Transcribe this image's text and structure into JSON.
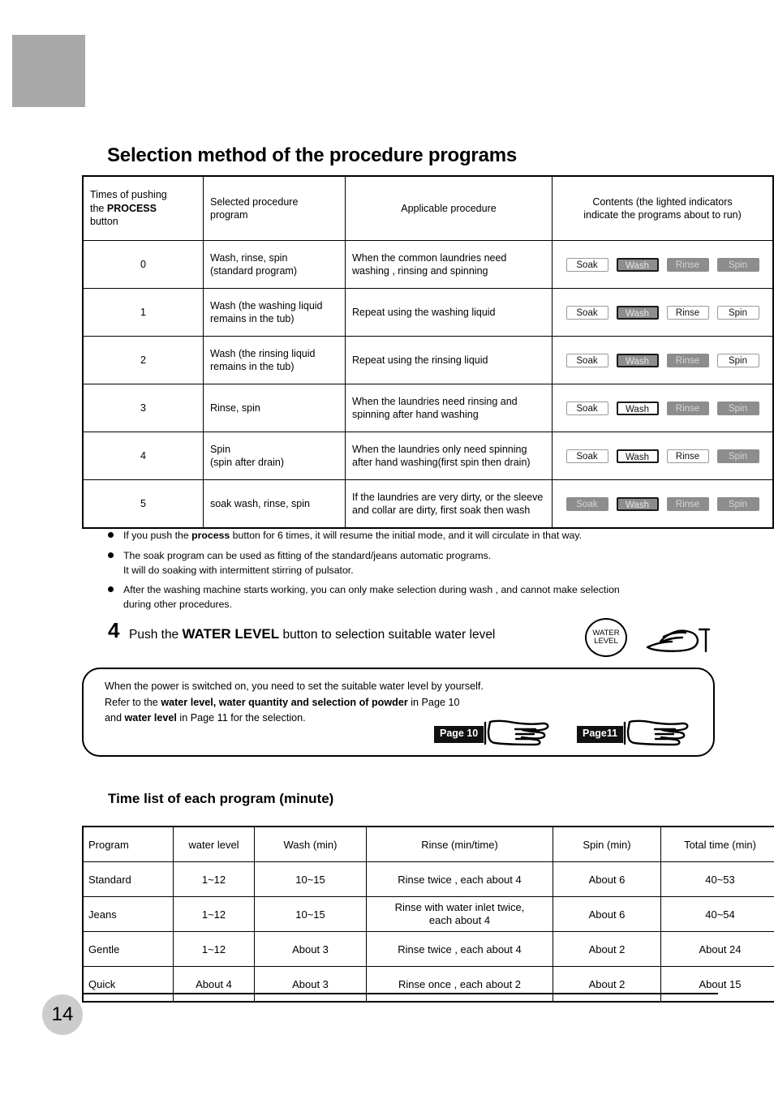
{
  "page": {
    "number": "14",
    "heading": "Selection method of the procedure programs"
  },
  "procedure_table": {
    "headers": {
      "times_line1": "Times of pushing",
      "times_line2_pre": "the ",
      "times_line2_strong": "PROCESS",
      "times_line3": "button",
      "selected_line1": "Selected procedure",
      "selected_line2": "program",
      "applicable": "Applicable procedure",
      "contents_line1": "Contents (the lighted indicators",
      "contents_line2": "indicate the programs about to run)"
    },
    "indicator_labels": [
      "Soak",
      "Wash",
      "Rinse",
      "Spin"
    ],
    "rows": [
      {
        "times": "0",
        "selected": "Wash, rinse, spin\n(standard program)",
        "applicable": "When the common laundries need\nwashing ,  rinsing  and spinning",
        "indicators": [
          {
            "label": "Soak",
            "state": "off"
          },
          {
            "label": "Wash",
            "state": "active"
          },
          {
            "label": "Rinse",
            "state": "lit"
          },
          {
            "label": "Spin",
            "state": "lit"
          }
        ]
      },
      {
        "times": "1",
        "selected": "Wash (the washing liquid\nremains  in the tub)",
        "applicable": "Repeat using the washing liquid",
        "indicators": [
          {
            "label": "Soak",
            "state": "off"
          },
          {
            "label": "Wash",
            "state": "active"
          },
          {
            "label": "Rinse",
            "state": "off"
          },
          {
            "label": "Spin",
            "state": "off"
          }
        ]
      },
      {
        "times": "2",
        "selected": "Wash (the rinsing liquid\nremains  in the tub)",
        "applicable": "Repeat using the rinsing liquid",
        "indicators": [
          {
            "label": "Soak",
            "state": "off"
          },
          {
            "label": "Wash",
            "state": "active"
          },
          {
            "label": "Rinse",
            "state": "lit"
          },
          {
            "label": "Spin",
            "state": "off"
          }
        ]
      },
      {
        "times": "3",
        "selected": "Rinse, spin",
        "applicable": "When the laundries need rinsing and\nspinning after hand  washing",
        "indicators": [
          {
            "label": "Soak",
            "state": "off"
          },
          {
            "label": "Wash",
            "state": "active-off"
          },
          {
            "label": "Rinse",
            "state": "lit"
          },
          {
            "label": "Spin",
            "state": "lit"
          }
        ]
      },
      {
        "times": "4",
        "selected": "Spin\n(spin after drain)",
        "applicable": "When the laundries only  need spinning\nafter hand washing(first spin then drain)",
        "indicators": [
          {
            "label": "Soak",
            "state": "off"
          },
          {
            "label": "Wash",
            "state": "active-off"
          },
          {
            "label": "Rinse",
            "state": "off"
          },
          {
            "label": "Spin",
            "state": "lit"
          }
        ]
      },
      {
        "times": "5",
        "selected": "soak  wash, rinse, spin",
        "applicable": "If the laundries are very dirty, or the sleeve\nand collar are dirty, first soak then wash",
        "indicators": [
          {
            "label": "Soak",
            "state": "lit"
          },
          {
            "label": "Wash",
            "state": "active"
          },
          {
            "label": "Rinse",
            "state": "lit"
          },
          {
            "label": "Spin",
            "state": "lit"
          }
        ]
      }
    ]
  },
  "bullets": [
    {
      "pre": "If you push the  ",
      "strong": "process",
      "post": "   button for 6 times, it will resume the initial mode, and it will circulate in that way."
    },
    {
      "pre": "The soak program can be used as fitting of the standard/jeans automatic programs.",
      "strong": "",
      "post": "",
      "second_line": "It will do soaking with intermittent stirring of pulsator."
    },
    {
      "pre": "After the washing machine starts working, you can only make selection during wash , and cannot make selection",
      "strong": "",
      "post": "",
      "second_line": "during other procedures."
    }
  ],
  "step4": {
    "number": "4",
    "text_pre": "Push the  ",
    "text_strong": "WATER LEVEL",
    "text_post": " button to selection suitable water level",
    "button_icon_line1": "WATER",
    "button_icon_line2": "LEVEL"
  },
  "note_box": {
    "line1": "When the power is switched on, you need to set the suitable water level by yourself.",
    "line2_pre": "Refer to the ",
    "line2_strong": "water level, water quantity and selection of powder",
    "line2_post": " in Page 10",
    "line3_pre": "and ",
    "line3_strong": "water level",
    "line3_post": " in Page 11 for the selection.",
    "tag1": "Page 10",
    "tag2": "Page11"
  },
  "time_list": {
    "title": "Time list of each program (minute)",
    "headers": [
      "Program",
      "water level",
      "Wash (min)",
      "Rinse (min/time)",
      "Spin (min)",
      "Total time (min)"
    ],
    "rows": [
      {
        "program": "Standard",
        "water_level": "1~12",
        "wash": "10~15",
        "rinse": "Rinse twice , each about 4",
        "spin": "About 6",
        "total": "40~53"
      },
      {
        "program": "Jeans",
        "water_level": "1~12",
        "wash": "10~15",
        "rinse": "Rinse with water inlet twice,\neach about 4",
        "spin": "About 6",
        "total": "40~54"
      },
      {
        "program": "Gentle",
        "water_level": "1~12",
        "wash": "About 3",
        "rinse": "Rinse twice , each about 4",
        "spin": "About 2",
        "total": "About 24"
      },
      {
        "program": "Quick",
        "water_level": "About  4",
        "wash": "About 3",
        "rinse": "Rinse once , each about 2",
        "spin": "About 2",
        "total": "About 15"
      }
    ]
  },
  "colors": {
    "lit_indicator": "#8d8d8d",
    "corner_block": "#a8a8a8",
    "page_badge": "#cccccc"
  }
}
